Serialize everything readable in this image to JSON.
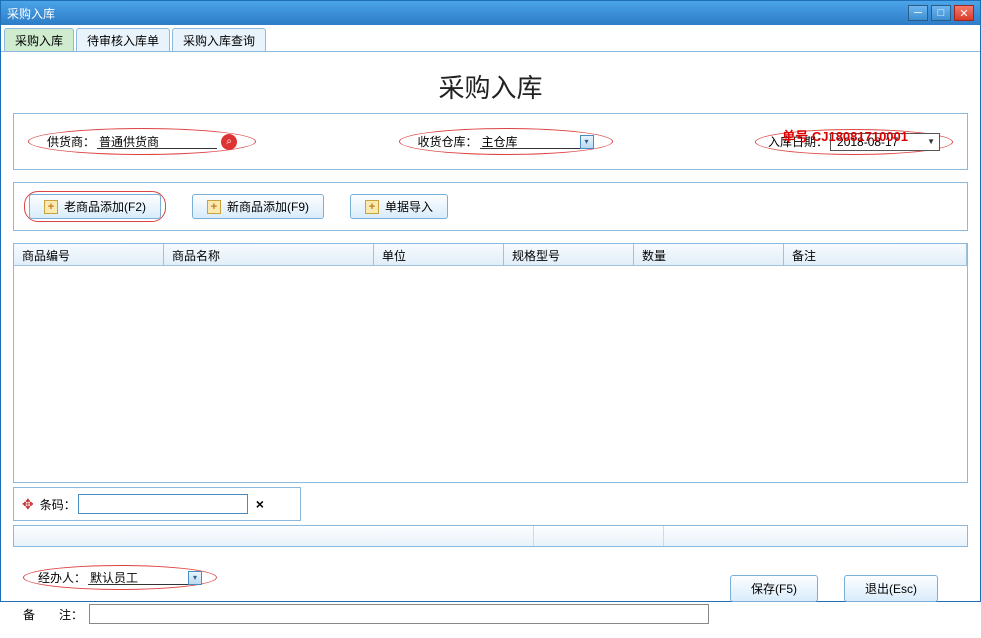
{
  "window": {
    "title": "采购入库"
  },
  "tabs": {
    "t1": "采购入库",
    "t2": "待审核入库单",
    "t3": "采购入库查询"
  },
  "page": {
    "title": "采购入库",
    "order_label": "单号",
    "order_no": "CJ18081710001"
  },
  "header": {
    "supplier_label": "供货商：",
    "supplier_value": "普通供货商",
    "warehouse_label": "收货仓库：",
    "warehouse_value": "主仓库",
    "date_label": "入库日期：",
    "date_value": "2018-08-17"
  },
  "toolbar": {
    "add_old": "老商品添加(F2)",
    "add_new": "新商品添加(F9)",
    "import": "单据导入"
  },
  "columns": {
    "c1": "商品编号",
    "c2": "商品名称",
    "c3": "单位",
    "c4": "规格型号",
    "c5": "数量",
    "c6": "备注"
  },
  "barcode": {
    "label": "条码：",
    "value": ""
  },
  "bottom": {
    "operator_label": "经办人：",
    "operator_value": "默认员工",
    "remark_label": "备　　注：",
    "remark_value": ""
  },
  "footer": {
    "save": "保存(F5)",
    "exit": "退出(Esc)"
  }
}
